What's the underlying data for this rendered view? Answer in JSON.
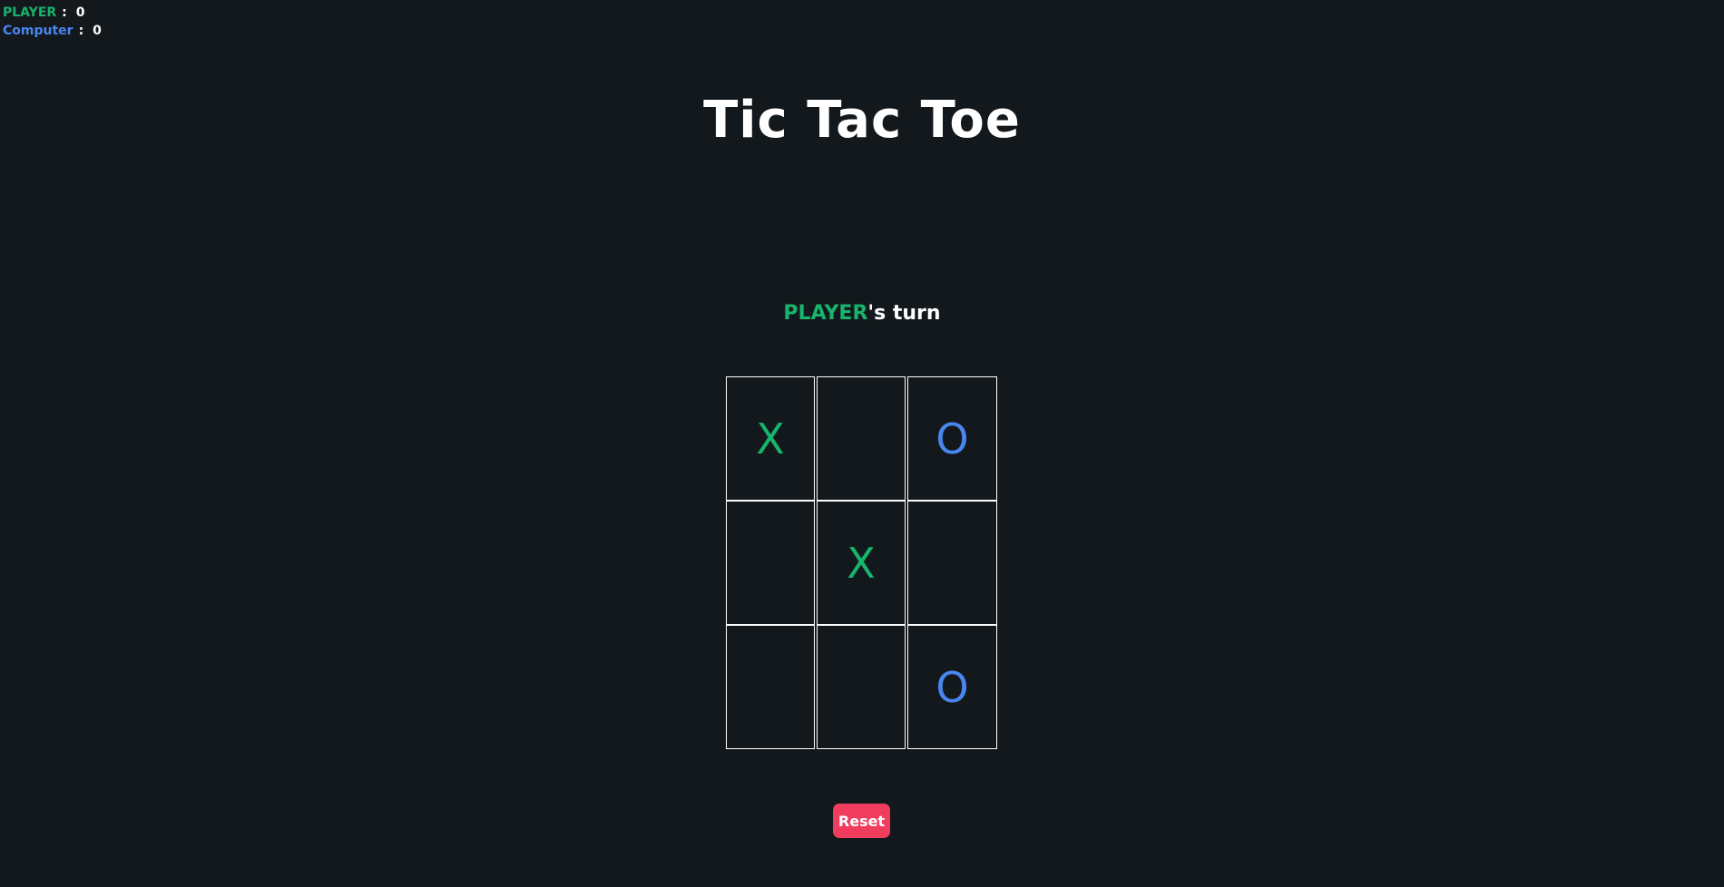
{
  "colors": {
    "background": "#13181c",
    "player": "#16b46c",
    "computer": "#4a86f0",
    "reset": "#f03c5d"
  },
  "scoreboard": {
    "player_label": "PLAYER",
    "player_score": "0",
    "computer_label": "Computer",
    "computer_score": "0",
    "separator": ":"
  },
  "title": "Tic Tac Toe",
  "turn": {
    "name": "PLAYER",
    "suffix": "'s turn"
  },
  "board": {
    "cells": [
      "X",
      "",
      "O",
      "",
      "X",
      "",
      "",
      "",
      "O"
    ]
  },
  "reset_label": "Reset"
}
